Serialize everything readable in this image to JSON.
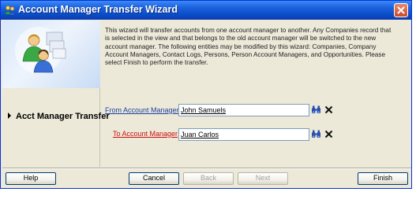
{
  "window": {
    "title": "Account Manager Transfer Wizard"
  },
  "sidebar": {
    "step_label": "Acct Manager Transfer"
  },
  "main": {
    "description": "This wizard will transfer accounts from one account manager to another. Any Companies record that is selected in the view and that belongs to the old account manager will be switched to the new account manager. The following entities may be modified by this wizard: Companies, Company Account Managers, Contact Logs, Persons, Person Account Managers, and Opportunities. Please select Finish to perform the transfer.",
    "from_label": "From Account Manager",
    "from_value": "John Samuels",
    "to_label": "To Account Manager",
    "to_value": "Juan Carlos"
  },
  "buttons": {
    "help": "Help",
    "cancel": "Cancel",
    "back": "Back",
    "next": "Next",
    "finish": "Finish"
  },
  "colors": {
    "titlebar": "#0a4ec8",
    "from_label": "#1b3fa0",
    "to_label": "#cc1111"
  }
}
